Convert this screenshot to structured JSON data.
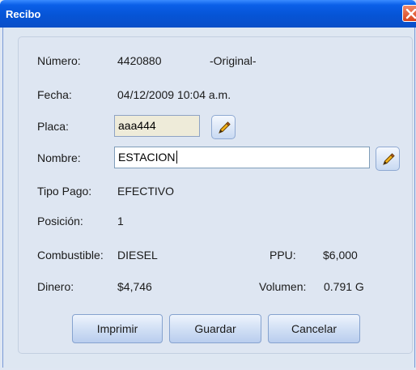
{
  "window": {
    "title": "Recibo"
  },
  "form": {
    "numero_label": "Número:",
    "numero_value": "4420880",
    "copy_status": "-Original-",
    "fecha_label": "Fecha:",
    "fecha_value": "04/12/2009 10:04 a.m.",
    "placa_label": "Placa:",
    "placa_value": "aaa444",
    "nombre_label": "Nombre:",
    "nombre_value": "ESTACION",
    "tipo_pago_label": "Tipo Pago:",
    "tipo_pago_value": "EFECTIVO",
    "posicion_label": "Posición:",
    "posicion_value": "1",
    "combustible_label": "Combustible:",
    "combustible_value": "DIESEL",
    "ppu_label": "PPU:",
    "ppu_value": "$6,000",
    "dinero_label": "Dinero:",
    "dinero_value": "$4,746",
    "volumen_label": "Volumen:",
    "volumen_value": "0.791 G"
  },
  "buttons": {
    "imprimir": "Imprimir",
    "guardar": "Guardar",
    "cancelar": "Cancelar"
  },
  "icons": {
    "edit": "pencil-icon",
    "close": "close-icon"
  },
  "colors": {
    "titlebar": "#0654d6",
    "close": "#d8431c",
    "background": "#dee7f2",
    "readonly_field": "#eeebd9"
  }
}
